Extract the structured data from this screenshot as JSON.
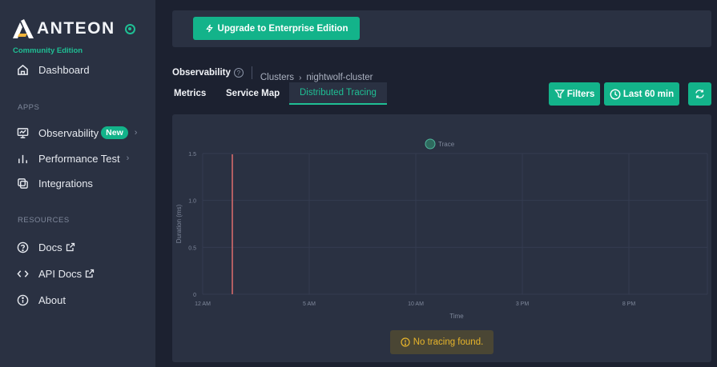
{
  "brand": {
    "name": "ANTEON",
    "edition": "Community Edition"
  },
  "sidebar": {
    "top_items": [
      {
        "label": "Dashboard",
        "icon": "home-icon"
      }
    ],
    "apps_heading": "APPS",
    "apps": [
      {
        "label": "Observability",
        "icon": "monitor-icon",
        "badge": "New"
      },
      {
        "label": "Performance Test",
        "icon": "bar-chart-icon"
      },
      {
        "label": "Integrations",
        "icon": "integrations-icon"
      }
    ],
    "resources_heading": "RESOURCES",
    "resources": [
      {
        "label": "Docs",
        "icon": "help-circle-icon"
      },
      {
        "label": "API Docs",
        "icon": "code-icon"
      },
      {
        "label": "About",
        "icon": "info-icon"
      }
    ]
  },
  "topbar": {
    "upgrade_label": "Upgrade to Enterprise Edition"
  },
  "breadcrumb": {
    "root": "Observability",
    "help": "?",
    "level1": "Clusters",
    "separator": "›",
    "level2": "nightwolf-cluster"
  },
  "tabs": [
    {
      "label": "Metrics",
      "active": false
    },
    {
      "label": "Service Map",
      "active": false
    },
    {
      "label": "Distributed Tracing",
      "active": true
    }
  ],
  "toolbar": {
    "filters_label": "Filters",
    "time_range_label": "Last 60 min",
    "refresh_icon": "refresh-icon"
  },
  "chart_data": {
    "type": "scatter",
    "title": "",
    "legend": [
      "Trace"
    ],
    "legend_position": "top-center",
    "xlabel": "Time",
    "ylabel": "Duration (ms)",
    "x_ticks": [
      "12 AM",
      "5 AM",
      "10 AM",
      "3 PM",
      "8 PM"
    ],
    "y_ticks": [
      "0",
      "0.5",
      "1.0",
      "1.5"
    ],
    "ylim": [
      0,
      1.5
    ],
    "series": [
      {
        "name": "Trace",
        "values": []
      }
    ],
    "grid": true,
    "current_time_marker": true
  },
  "empty_state": {
    "message": "No tracing found."
  },
  "colors": {
    "accent": "#13b38a",
    "warning": "#e8b52b",
    "marker_line": "#d46a6a"
  }
}
